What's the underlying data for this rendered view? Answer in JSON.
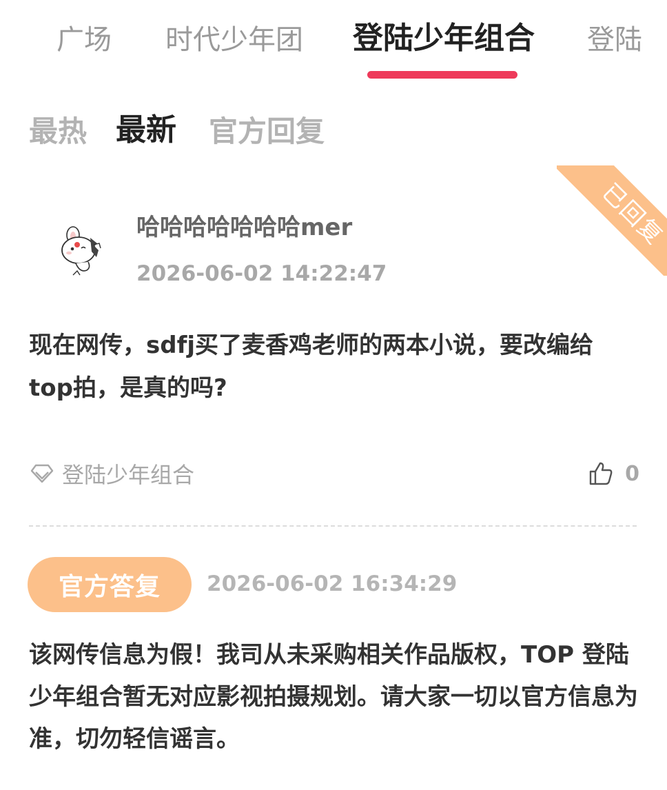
{
  "top_tabs": [
    "广场",
    "时代少年团",
    "登陆少年组合",
    "登陆"
  ],
  "sub_tabs": [
    "最热",
    "最新",
    "官方回复"
  ],
  "post": {
    "status_ribbon": "已回复",
    "username": "哈哈哈哈哈哈哈mer",
    "time": "2026-06-02 14:22:47",
    "content": "现在网传，sdfj买了麦香鸡老师的两本小说，要改编给top拍，是真的吗?",
    "tag": "登陆少年组合",
    "like_count": "0"
  },
  "reply": {
    "badge": "官方答复",
    "time": "2026-06-02 16:34:29",
    "content": "该网传信息为假！我司从未采购相关作品版权，TOP 登陆少年组合暂无对应影视拍摄规划。请大家一切以官方信息为准，切勿轻信谣言。"
  },
  "colors": {
    "accent_underline": "#ee3a5a",
    "official_orange": "#fcc08a"
  },
  "icons": [
    "rabbit-avatar-icon",
    "diamond-tag-icon",
    "thumb-up-icon"
  ]
}
